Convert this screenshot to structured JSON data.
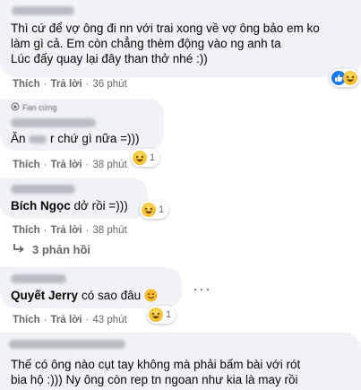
{
  "actions": {
    "like": "Thích",
    "reply": "Trả lời"
  },
  "comments": [
    {
      "text_line1": "Thì cứ để vợ ông đi nn với trai xong về vợ ông bảo em ko",
      "text_line2": "làm gì cả. Em còn chẳng thèm động vào ng anh ta",
      "text_line3": "Lúc đấy quay lại đây than thở nhé :))",
      "time": "36 phút",
      "reaction": {
        "icon": "like-icon",
        "count": ""
      }
    },
    {
      "badge_icon": "fan-badge-icon",
      "badge_label": "Fan cứng",
      "text_prefix": "Ăn",
      "text_suffix": "r chứ gì nữa =)))",
      "time": "38 phút",
      "reaction": {
        "icon": "haha-emoji-icon",
        "count": "1"
      }
    },
    {
      "tag": "Bích Ngọc",
      "text": "dở rồi =)))",
      "time": "38 phút",
      "reaction": {
        "icon": "haha-emoji-icon",
        "count": "1"
      }
    },
    {
      "tag": "Quyết Jerry",
      "text": "có sao đâu",
      "emoji": "🙂",
      "time": "43 phút",
      "reaction": {
        "icon": "haha-emoji-icon",
        "count": "1"
      }
    },
    {
      "text_line1": "Thế có ông nào cụt tay không mà phải bấm bài với rót",
      "text_line2": "bia hộ :))) Ny ông còn rep tn ngoan như kia là may rồi"
    }
  ],
  "replies": {
    "icon": "reply-arrow-icon",
    "label": "3 phản hồi"
  },
  "more_icon": "more-options-icon",
  "colors": {
    "bubble": "#f0f2f5",
    "meta": "#65676b",
    "like_blue": "#1877f2",
    "haha_yellow": "#f7b928"
  }
}
